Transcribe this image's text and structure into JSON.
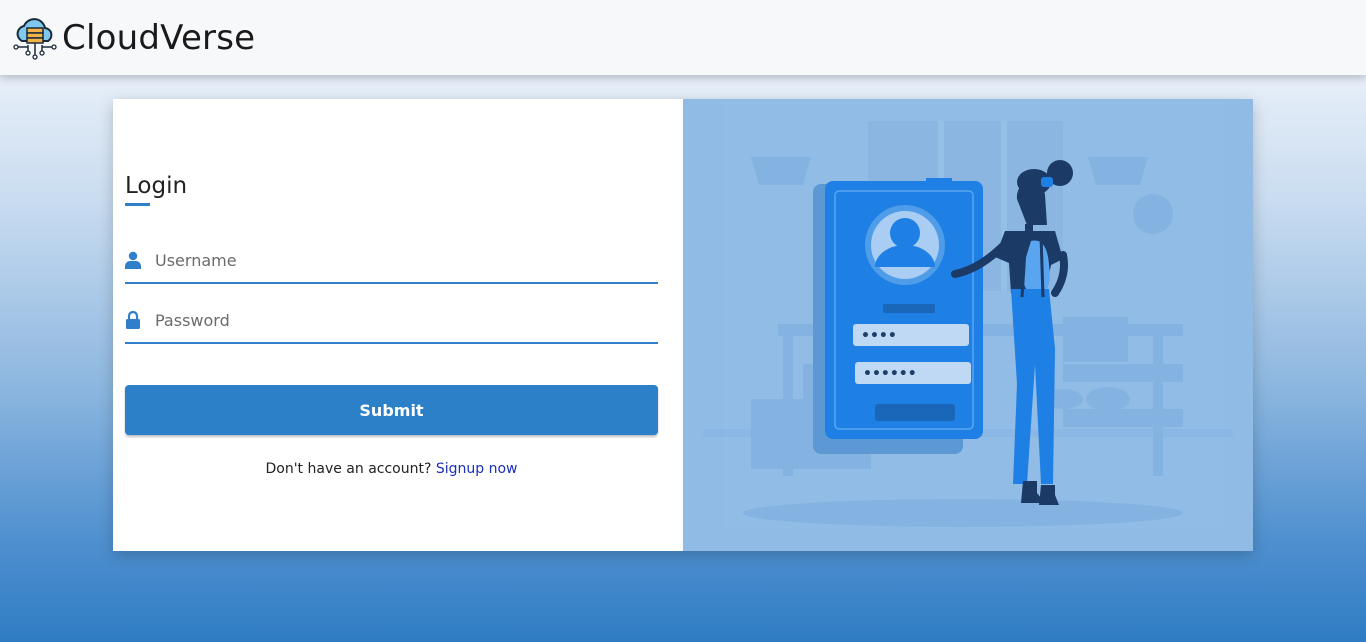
{
  "brand": {
    "name": "CloudVerse",
    "logo_icon": "cloud-server-icon"
  },
  "login": {
    "title": "Login",
    "username_placeholder": "Username",
    "password_placeholder": "Password",
    "submit_label": "Submit",
    "signup_prompt": "Don't have an account?",
    "signup_link": "Signup now"
  },
  "illustration": {
    "masked_username": "••••",
    "masked_password": "••••••"
  },
  "colors": {
    "accent": "#2b80c8",
    "art_background": "#8fbbe5",
    "link": "#1a2fb8"
  }
}
